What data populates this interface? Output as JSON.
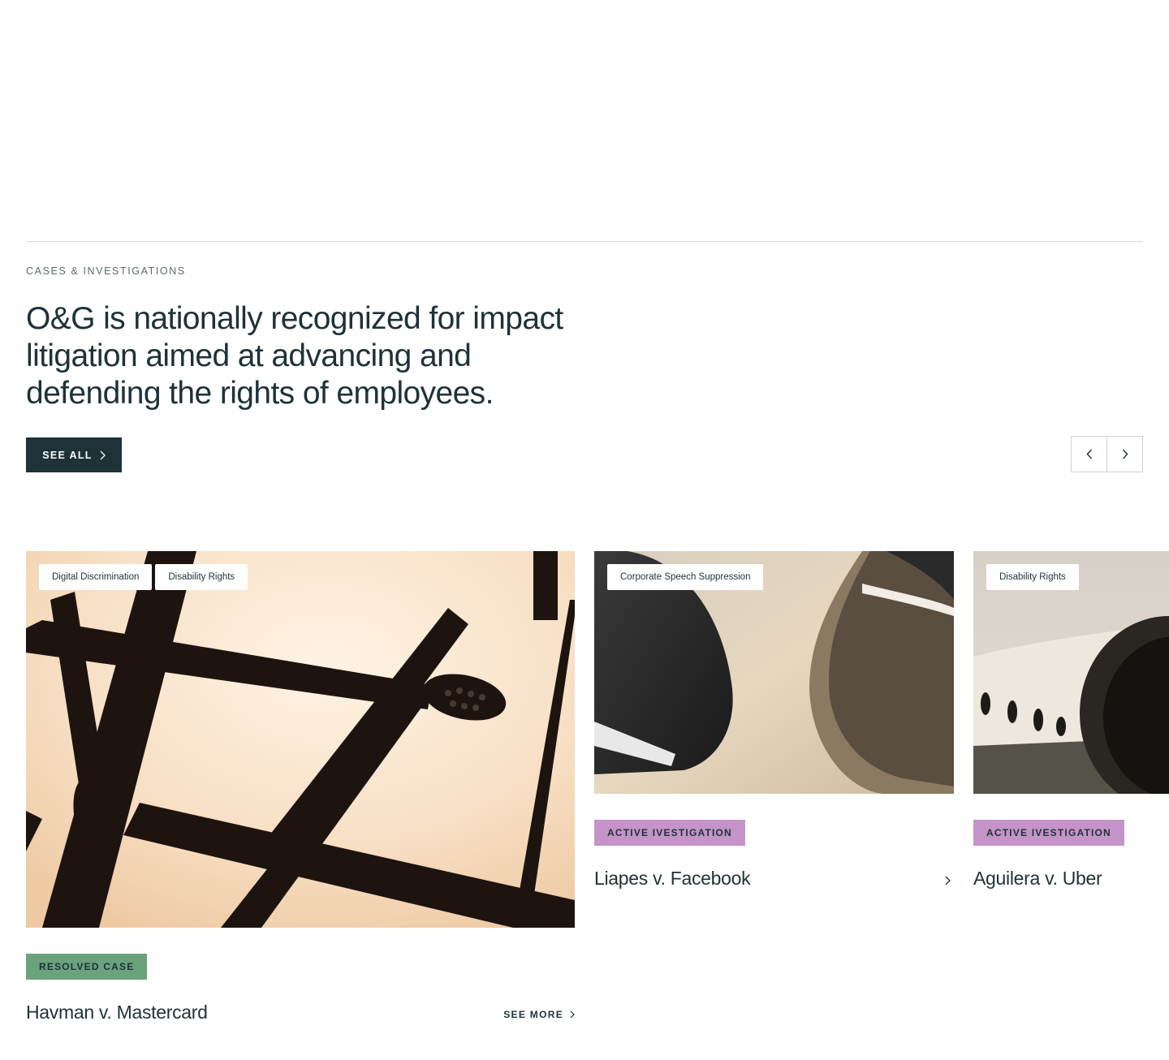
{
  "section": {
    "eyebrow": "CASES & INVESTIGATIONS",
    "headline": "O&G is nationally recognized for impact litigation aimed at advancing and defending the rights of employees.",
    "see_all_label": "SEE ALL"
  },
  "carousel": {
    "prev_icon": "chevron-left-icon",
    "next_icon": "chevron-right-icon"
  },
  "cards": [
    {
      "tags": [
        "Digital Discrimination",
        "Disability Rights"
      ],
      "status": "RESOLVED CASE",
      "title": "Havman v. Mastercard",
      "see_more": "SEE MORE"
    },
    {
      "tags": [
        "Corporate Speech Suppression"
      ],
      "status": "ACTIVE IVESTIGATION",
      "title": "Liapes v. Facebook"
    },
    {
      "tags": [
        "Disability Rights"
      ],
      "status": "ACTIVE IVESTIGATION",
      "title": "Aguilera v. Uber"
    }
  ],
  "colors": {
    "primary": "#1e3238",
    "resolved": "#6aa27c",
    "active": "#c493c8",
    "divider": "#d9dcdc"
  }
}
